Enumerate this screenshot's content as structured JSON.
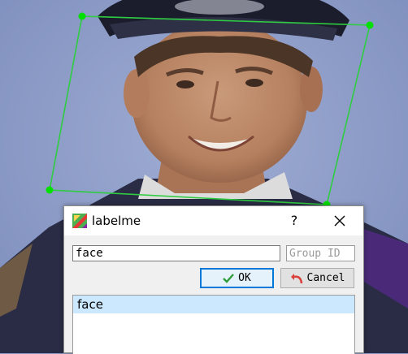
{
  "dialog": {
    "title": "labelme",
    "help_symbol": "?",
    "label_value": "face",
    "group_id_placeholder": "Group ID",
    "ok_label": "OK",
    "cancel_label": "Cancel",
    "label_list": [
      {
        "label": "face",
        "selected": true
      }
    ]
  },
  "icons": {
    "app": "labelme-app-icon",
    "close": "close-icon",
    "ok": "check-icon",
    "cancel": "undo-arrow-icon"
  },
  "colors": {
    "polygon": "#2ecc40",
    "vertex": "#00e000",
    "ok_border": "#0078d7",
    "selected_item": "#cce8ff",
    "cancel_arrow": "#d9413a",
    "check": "#2e9e3a"
  }
}
